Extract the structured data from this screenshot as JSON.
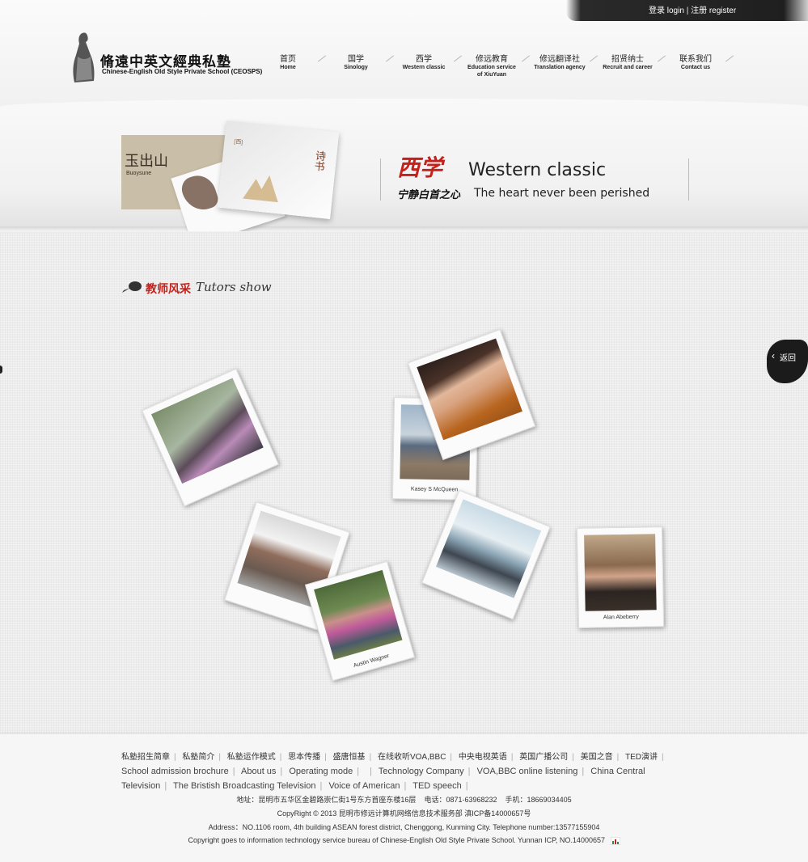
{
  "topbar": {
    "login": "登录 login",
    "register": "注册 register"
  },
  "logo": {
    "cn": "脩遠中英文經典私塾",
    "en": "Chinese-English Old Style Private School (CEOSPS)"
  },
  "nav": [
    {
      "cn": "首页",
      "en": "Home"
    },
    {
      "cn": "国学",
      "en": "Sinology"
    },
    {
      "cn": "西学",
      "en": "Western classic"
    },
    {
      "cn": "修远教育",
      "en": "Education service",
      "en2": "of XiuYuan"
    },
    {
      "cn": "修远翻译社",
      "en": "Translation agency"
    },
    {
      "cn": "招贤纳士",
      "en": "Recruit and career"
    },
    {
      "cn": "联系我们",
      "en": "Contact us"
    }
  ],
  "banner": {
    "card_title": "玉出山",
    "card_sub": "Buoysune",
    "card_tag": "[西]",
    "card_seal": "诗书",
    "cn_title": "西学",
    "en_title": "Western classic",
    "cn_sub": "宁静白首之心",
    "en_sub": "The heart never been perished"
  },
  "section": {
    "cn": "教师风采",
    "en": "Tutors show"
  },
  "back_label": "返回",
  "tutors": [
    {
      "caption": ""
    },
    {
      "caption": "Kasey S McQueen"
    },
    {
      "caption": ""
    },
    {
      "caption": ""
    },
    {
      "caption": "Austin Wagner"
    },
    {
      "caption": ""
    },
    {
      "caption": "Alan Abeberry"
    }
  ],
  "footer": {
    "links_cn": [
      "私塾招生简章",
      "私塾简介",
      "私塾运作模式",
      "思本传播",
      "盛唐恒基",
      "在线收听VOA,BBC",
      "中央电视英语",
      "英国广播公司",
      "美国之音",
      "TED演讲"
    ],
    "links_en": [
      "School admission brochure",
      "About us",
      "Operating mode",
      "",
      "Technology Company",
      "VOA,BBC online listening",
      "China Central Television",
      "The Bristish Broadcasting Television",
      "Voice of American",
      "TED speech"
    ],
    "address_cn": "地址：昆明市五华区金碧路崇仁街1号东方首座东楼16层",
    "phone_cn": "电话：0871-63968232",
    "mobile_cn": "手机：18669034405",
    "copyright_cn": "CopyRight © 2013 昆明市修远计算机网络信息技术服务部 滇ICP备14000657号",
    "address_en": "Address：NO.1106 room, 4th building ASEAN forest district, Chenggong, Kunming City. Telephone number:13577155904",
    "copyright_en": "Copyright goes to information technology service bureau of Chinese-English Old Style Private School. Yunnan ICP, NO.14000657"
  },
  "colors": {
    "accent_red": "#c4211b",
    "ink": "#1f1f1f"
  }
}
